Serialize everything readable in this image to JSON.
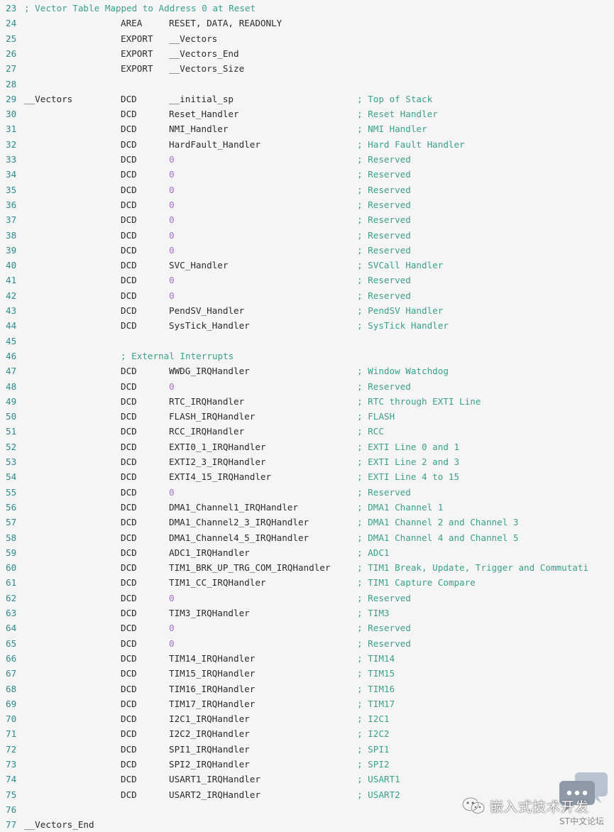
{
  "colors": {
    "background": "#f5f5f5",
    "line_number": "#2e8b8b",
    "code_text": "#2b2b2b",
    "comment": "#3aa08a",
    "numeric_literal": "#a86fc9"
  },
  "code": {
    "lines": [
      {
        "n": "23",
        "comment_full": "; Vector Table Mapped to Address 0 at Reset"
      },
      {
        "n": "24",
        "op": "AREA",
        "arg": "RESET, DATA, READONLY"
      },
      {
        "n": "25",
        "op": "EXPORT",
        "arg": "__Vectors"
      },
      {
        "n": "26",
        "op": "EXPORT",
        "arg": "__Vectors_End"
      },
      {
        "n": "27",
        "op": "EXPORT",
        "arg": "__Vectors_Size"
      },
      {
        "n": "28"
      },
      {
        "n": "29",
        "label": "__Vectors",
        "op": "DCD",
        "arg": "__initial_sp",
        "comment": "; Top of Stack"
      },
      {
        "n": "30",
        "op": "DCD",
        "arg": "Reset_Handler",
        "comment": "; Reset Handler"
      },
      {
        "n": "31",
        "op": "DCD",
        "arg": "NMI_Handler",
        "comment": "; NMI Handler"
      },
      {
        "n": "32",
        "op": "DCD",
        "arg": "HardFault_Handler",
        "comment": "; Hard Fault Handler"
      },
      {
        "n": "33",
        "op": "DCD",
        "arg": "0",
        "comment": "; Reserved"
      },
      {
        "n": "34",
        "op": "DCD",
        "arg": "0",
        "comment": "; Reserved"
      },
      {
        "n": "35",
        "op": "DCD",
        "arg": "0",
        "comment": "; Reserved"
      },
      {
        "n": "36",
        "op": "DCD",
        "arg": "0",
        "comment": "; Reserved"
      },
      {
        "n": "37",
        "op": "DCD",
        "arg": "0",
        "comment": "; Reserved"
      },
      {
        "n": "38",
        "op": "DCD",
        "arg": "0",
        "comment": "; Reserved"
      },
      {
        "n": "39",
        "op": "DCD",
        "arg": "0",
        "comment": "; Reserved"
      },
      {
        "n": "40",
        "op": "DCD",
        "arg": "SVC_Handler",
        "comment": "; SVCall Handler"
      },
      {
        "n": "41",
        "op": "DCD",
        "arg": "0",
        "comment": "; Reserved"
      },
      {
        "n": "42",
        "op": "DCD",
        "arg": "0",
        "comment": "; Reserved"
      },
      {
        "n": "43",
        "op": "DCD",
        "arg": "PendSV_Handler",
        "comment": "; PendSV Handler"
      },
      {
        "n": "44",
        "op": "DCD",
        "arg": "SysTick_Handler",
        "comment": "; SysTick Handler"
      },
      {
        "n": "45"
      },
      {
        "n": "46",
        "comment_indented": "; External Interrupts"
      },
      {
        "n": "47",
        "op": "DCD",
        "arg": "WWDG_IRQHandler",
        "comment": "; Window Watchdog"
      },
      {
        "n": "48",
        "op": "DCD",
        "arg": "0",
        "comment": "; Reserved"
      },
      {
        "n": "49",
        "op": "DCD",
        "arg": "RTC_IRQHandler",
        "comment": "; RTC through EXTI Line"
      },
      {
        "n": "50",
        "op": "DCD",
        "arg": "FLASH_IRQHandler",
        "comment": "; FLASH"
      },
      {
        "n": "51",
        "op": "DCD",
        "arg": "RCC_IRQHandler",
        "comment": "; RCC"
      },
      {
        "n": "52",
        "op": "DCD",
        "arg": "EXTI0_1_IRQHandler",
        "comment": "; EXTI Line 0 and 1"
      },
      {
        "n": "53",
        "op": "DCD",
        "arg": "EXTI2_3_IRQHandler",
        "comment": "; EXTI Line 2 and 3"
      },
      {
        "n": "54",
        "op": "DCD",
        "arg": "EXTI4_15_IRQHandler",
        "comment": "; EXTI Line 4 to 15"
      },
      {
        "n": "55",
        "op": "DCD",
        "arg": "0",
        "comment": "; Reserved"
      },
      {
        "n": "56",
        "op": "DCD",
        "arg": "DMA1_Channel1_IRQHandler",
        "comment": "; DMA1 Channel 1"
      },
      {
        "n": "57",
        "op": "DCD",
        "arg": "DMA1_Channel2_3_IRQHandler",
        "comment": "; DMA1 Channel 2 and Channel 3"
      },
      {
        "n": "58",
        "op": "DCD",
        "arg": "DMA1_Channel4_5_IRQHandler",
        "comment": "; DMA1 Channel 4 and Channel 5"
      },
      {
        "n": "59",
        "op": "DCD",
        "arg": "ADC1_IRQHandler",
        "comment": "; ADC1"
      },
      {
        "n": "60",
        "op": "DCD",
        "arg": "TIM1_BRK_UP_TRG_COM_IRQHandler",
        "comment": "; TIM1 Break, Update, Trigger and Commutati"
      },
      {
        "n": "61",
        "op": "DCD",
        "arg": "TIM1_CC_IRQHandler",
        "comment": "; TIM1 Capture Compare"
      },
      {
        "n": "62",
        "op": "DCD",
        "arg": "0",
        "comment": "; Reserved"
      },
      {
        "n": "63",
        "op": "DCD",
        "arg": "TIM3_IRQHandler",
        "comment": "; TIM3"
      },
      {
        "n": "64",
        "op": "DCD",
        "arg": "0",
        "comment": "; Reserved"
      },
      {
        "n": "65",
        "op": "DCD",
        "arg": "0",
        "comment": "; Reserved"
      },
      {
        "n": "66",
        "op": "DCD",
        "arg": "TIM14_IRQHandler",
        "comment": "; TIM14"
      },
      {
        "n": "67",
        "op": "DCD",
        "arg": "TIM15_IRQHandler",
        "comment": "; TIM15"
      },
      {
        "n": "68",
        "op": "DCD",
        "arg": "TIM16_IRQHandler",
        "comment": "; TIM16"
      },
      {
        "n": "69",
        "op": "DCD",
        "arg": "TIM17_IRQHandler",
        "comment": "; TIM17"
      },
      {
        "n": "70",
        "op": "DCD",
        "arg": "I2C1_IRQHandler",
        "comment": "; I2C1"
      },
      {
        "n": "71",
        "op": "DCD",
        "arg": "I2C2_IRQHandler",
        "comment": "; I2C2"
      },
      {
        "n": "72",
        "op": "DCD",
        "arg": "SPI1_IRQHandler",
        "comment": "; SPI1"
      },
      {
        "n": "73",
        "op": "DCD",
        "arg": "SPI2_IRQHandler",
        "comment": "; SPI2"
      },
      {
        "n": "74",
        "op": "DCD",
        "arg": "USART1_IRQHandler",
        "comment": "; USART1"
      },
      {
        "n": "75",
        "op": "DCD",
        "arg": "USART2_IRQHandler",
        "comment": "; USART2"
      },
      {
        "n": "76"
      },
      {
        "n": "77",
        "label": "__Vectors_End"
      }
    ]
  },
  "watermark": {
    "brand": "嵌入式技术开发",
    "sub": "ST中文论坛",
    "brand_icon": "wechat-icon",
    "chat_icon": "chat-bubbles-icon"
  }
}
